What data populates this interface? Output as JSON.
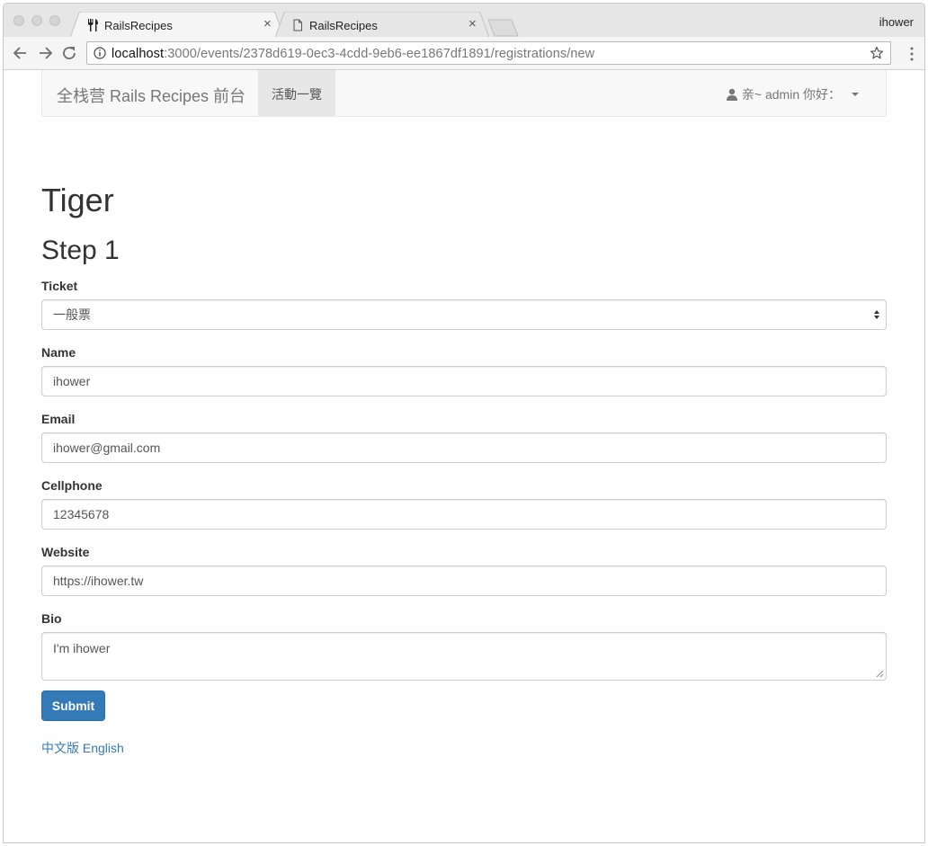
{
  "browser": {
    "tabs": [
      {
        "title": "RailsRecipes",
        "icon": "fork-knife-icon",
        "active": true
      },
      {
        "title": "RailsRecipes",
        "icon": "document-icon",
        "active": false
      }
    ],
    "close_glyph": "×",
    "profile_name": "ihower",
    "url_host": "localhost",
    "url_rest": ":3000/events/2378d619-0ec3-4cdd-9eb6-ee1867df1891/registrations/new"
  },
  "navbar": {
    "brand": "全栈营 Rails Recipes 前台",
    "active_item": "活動一覽",
    "user_label": "亲~ admin 你好："
  },
  "page": {
    "title": "Tiger",
    "step": "Step 1"
  },
  "form": {
    "ticket": {
      "label": "Ticket",
      "value": "一般票"
    },
    "name": {
      "label": "Name",
      "value": "ihower"
    },
    "email": {
      "label": "Email",
      "value": "ihower@gmail.com"
    },
    "cellphone": {
      "label": "Cellphone",
      "value": "12345678"
    },
    "website": {
      "label": "Website",
      "value": "https://ihower.tw"
    },
    "bio": {
      "label": "Bio",
      "value": "I'm ihower"
    },
    "submit_label": "Submit"
  },
  "footer": {
    "lang_zh": "中文版",
    "lang_en": "English"
  },
  "colors": {
    "link": "#337ab7",
    "primary_button": "#337ab7",
    "navbar_bg": "#f8f8f8"
  }
}
